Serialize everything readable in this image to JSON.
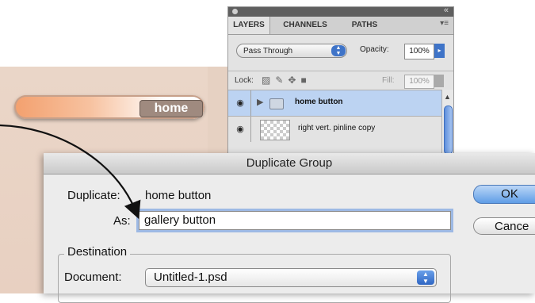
{
  "canvas": {
    "home_button_label": "home"
  },
  "layers_panel": {
    "tabs": [
      "LAYERS",
      "CHANNELS",
      "PATHS"
    ],
    "collapse_icon": "double-chevron-icon",
    "menu_icon": "panel-menu-icon",
    "blend_mode": "Pass Through",
    "opacity_label": "Opacity:",
    "opacity_value": "100%",
    "lock_label": "Lock:",
    "fill_label": "Fill:",
    "fill_value": "100%",
    "layers": [
      {
        "name": "home button",
        "type": "group",
        "selected": true
      },
      {
        "name": "right vert. pinline copy",
        "type": "layer",
        "selected": false
      }
    ]
  },
  "dialog": {
    "title": "Duplicate Group",
    "duplicate_label": "Duplicate:",
    "duplicate_value": "home button",
    "as_label": "As:",
    "as_value": "gallery button",
    "destination_legend": "Destination",
    "document_label": "Document:",
    "document_value": "Untitled-1.psd",
    "ok_label": "OK",
    "cancel_label": "Cance"
  },
  "colors": {
    "selection_blue": "#bcd3f2",
    "ok_button_blue": "#5f9de6",
    "home_button_orange": "#f3a06e"
  }
}
